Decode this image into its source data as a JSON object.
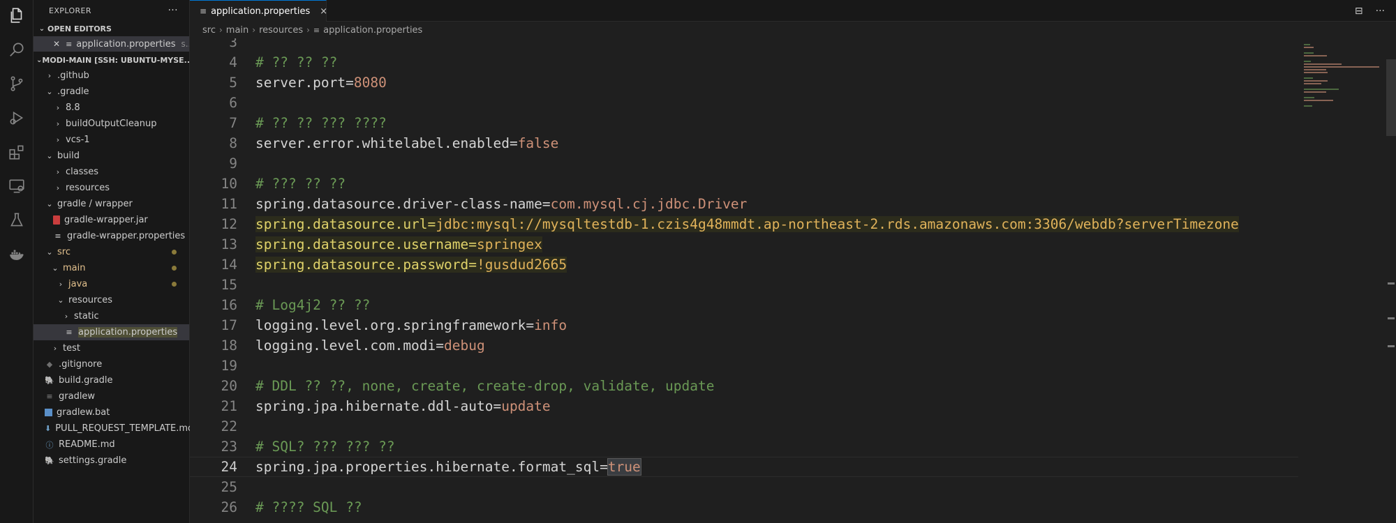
{
  "activity_bar": {
    "items": [
      {
        "name": "explorer-icon"
      },
      {
        "name": "search-icon"
      },
      {
        "name": "source-control-icon"
      },
      {
        "name": "run-debug-icon"
      },
      {
        "name": "extensions-icon"
      },
      {
        "name": "remote-explorer-icon"
      },
      {
        "name": "testing-icon"
      },
      {
        "name": "docker-icon"
      }
    ]
  },
  "sidebar": {
    "title": "EXPLORER",
    "more": "···",
    "open_editors_label": "OPEN EDITORS",
    "open_editor_file": "application.properties",
    "open_editor_desc": "s...",
    "workspace_label": "MODI-MAIN [SSH: UBUNTU-MYSE...",
    "tree": [
      {
        "label": ".github",
        "chev": "›"
      },
      {
        "label": ".gradle",
        "chev": "⌄"
      },
      {
        "label": "8.8",
        "chev": "›"
      },
      {
        "label": "buildOutputCleanup",
        "chev": "›"
      },
      {
        "label": "vcs-1",
        "chev": "›"
      },
      {
        "label": "build",
        "chev": "⌄"
      },
      {
        "label": "classes",
        "chev": "›"
      },
      {
        "label": "resources",
        "chev": "›"
      },
      {
        "label": "gradle / wrapper",
        "chev": "⌄"
      },
      {
        "label": "gradle-wrapper.jar",
        "chev": ""
      },
      {
        "label": "gradle-wrapper.properties",
        "chev": ""
      },
      {
        "label": "src",
        "chev": "⌄"
      },
      {
        "label": "main",
        "chev": "⌄"
      },
      {
        "label": "java",
        "chev": "›"
      },
      {
        "label": "resources",
        "chev": "⌄"
      },
      {
        "label": "static",
        "chev": "›"
      },
      {
        "label": "application.properties",
        "chev": ""
      },
      {
        "label": "test",
        "chev": "›"
      },
      {
        "label": ".gitignore",
        "chev": ""
      },
      {
        "label": "build.gradle",
        "chev": ""
      },
      {
        "label": "gradlew",
        "chev": ""
      },
      {
        "label": "gradlew.bat",
        "chev": ""
      },
      {
        "label": "PULL_REQUEST_TEMPLATE.md",
        "chev": ""
      },
      {
        "label": "README.md",
        "chev": ""
      },
      {
        "label": "settings.gradle",
        "chev": ""
      }
    ]
  },
  "tabs": [
    {
      "label": "application.properties",
      "close": "×"
    }
  ],
  "tab_actions": {
    "split": "⊟",
    "more": "···"
  },
  "breadcrumb": [
    "src",
    "main",
    "resources",
    "application.properties"
  ],
  "editor": {
    "active_line": "24",
    "lines": [
      {
        "n": "3",
        "k": "",
        "v": "",
        "c": ""
      },
      {
        "n": "4",
        "k": "",
        "v": "",
        "c": "# ?? ?? ??"
      },
      {
        "n": "5",
        "k": "server.port=",
        "v": "8080",
        "c": ""
      },
      {
        "n": "6",
        "k": "",
        "v": "",
        "c": ""
      },
      {
        "n": "7",
        "k": "",
        "v": "",
        "c": "# ?? ?? ??? ????"
      },
      {
        "n": "8",
        "k": "server.error.whitelabel.enabled=",
        "v": "false",
        "c": ""
      },
      {
        "n": "9",
        "k": "",
        "v": "",
        "c": ""
      },
      {
        "n": "10",
        "k": "",
        "v": "",
        "c": "# ??? ?? ??"
      },
      {
        "n": "11",
        "k": "spring.datasource.driver-class-name=",
        "v": "com.mysql.cj.jdbc.Driver",
        "c": ""
      },
      {
        "n": "12",
        "k": "spring.datasource.url=",
        "v": "jdbc:mysql://mysqltestdb-1.czis4g48mmdt.ap-northeast-2.rds.amazonaws.com:3306/webdb?serverTimezone",
        "c": ""
      },
      {
        "n": "13",
        "k": "spring.datasource.username=",
        "v": "springex",
        "c": ""
      },
      {
        "n": "14",
        "k": "spring.datasource.password=",
        "v": "!gusdud2665",
        "c": ""
      },
      {
        "n": "15",
        "k": "",
        "v": "",
        "c": ""
      },
      {
        "n": "16",
        "k": "",
        "v": "",
        "c": "# Log4j2 ?? ??"
      },
      {
        "n": "17",
        "k": "logging.level.org.springframework=",
        "v": "info",
        "c": ""
      },
      {
        "n": "18",
        "k": "logging.level.com.modi=",
        "v": "debug",
        "c": ""
      },
      {
        "n": "19",
        "k": "",
        "v": "",
        "c": ""
      },
      {
        "n": "20",
        "k": "",
        "v": "",
        "c": "# DDL ?? ??, none, create, create-drop, validate, update"
      },
      {
        "n": "21",
        "k": "spring.jpa.hibernate.ddl-auto=",
        "v": "update",
        "c": ""
      },
      {
        "n": "22",
        "k": "",
        "v": "",
        "c": ""
      },
      {
        "n": "23",
        "k": "",
        "v": "",
        "c": "# SQL? ??? ??? ??"
      },
      {
        "n": "24",
        "k": "spring.jpa.properties.hibernate.format_sql=",
        "v": "true",
        "c": ""
      },
      {
        "n": "25",
        "k": "",
        "v": "",
        "c": ""
      },
      {
        "n": "26",
        "k": "",
        "v": "",
        "c": "# ???? SQL ??"
      }
    ]
  },
  "colors": {
    "accent": "#0078d4",
    "key": "#d4d4d4",
    "value": "#ce9178",
    "comment": "#6a9955",
    "modified": "#e2c08d"
  }
}
